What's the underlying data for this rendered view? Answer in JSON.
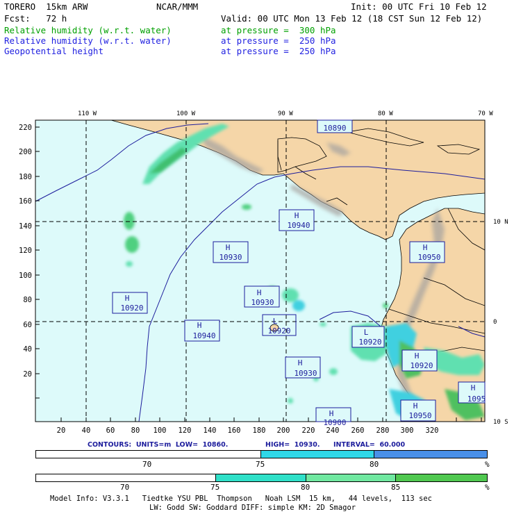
{
  "header": {
    "model": "TORERO  15km ARW",
    "center": "NCAR/MMM",
    "init": "Init: 00 UTC Fri 10 Feb 12",
    "fcst": "Fcst:   72 h",
    "valid": "Valid: 00 UTC Mon 13 Feb 12 (18 CST Sun 12 Feb 12)",
    "fields": [
      {
        "name": "Relative humidity (w.r.t. water)",
        "level": "at pressure =  300 hPa",
        "color": "#00a000"
      },
      {
        "name": "Relative humidity (w.r.t. water)",
        "level": "at pressure =  250 hPa",
        "color": "#1e1ee0"
      },
      {
        "name": "Geopotential height",
        "level": "at pressure =  250 hPa",
        "color": "#1e1ee0"
      }
    ]
  },
  "map": {
    "top_lon_labels": [
      "110 W",
      "100 W",
      "90 W",
      "80 W",
      "70 W"
    ],
    "right_lat_labels": [
      "10 N",
      "0",
      "10 S"
    ],
    "left_y_ticks": [
      "220",
      "200",
      "180",
      "160",
      "140",
      "120",
      "100",
      "80",
      "60",
      "40",
      "20"
    ],
    "bottom_x_ticks": [
      "20",
      "40",
      "60",
      "80",
      "100",
      "120",
      "140",
      "160",
      "180",
      "200",
      "220",
      "240",
      "260",
      "280",
      "300",
      "320"
    ],
    "highs_lows": [
      {
        "type": "H",
        "value": "10890"
      },
      {
        "type": "H",
        "value": "10940"
      },
      {
        "type": "H",
        "value": "10930"
      },
      {
        "type": "H",
        "value": "10950"
      },
      {
        "type": "H",
        "value": "10920"
      },
      {
        "type": "H",
        "value": "10930"
      },
      {
        "type": "H",
        "value": "10940"
      },
      {
        "type": "L",
        "value": "10920"
      },
      {
        "type": "L",
        "value": "10920"
      },
      {
        "type": "H",
        "value": "10930"
      },
      {
        "type": "H",
        "value": "10920"
      },
      {
        "type": "H",
        "value": "1095"
      },
      {
        "type": "H",
        "value": "10950"
      },
      {
        "type": "H",
        "value": "10900"
      }
    ],
    "colors": {
      "ocean": "#ddfafa",
      "land": "#f5d6a8",
      "terrain_gray": "#a8a4a0",
      "contour": "#1c1c9c"
    }
  },
  "contour_info": {
    "units": "CONTOURS:  UNITS=m  LOW=  10860.",
    "high": "HIGH=  10930.",
    "interval": "INTERVAL=  60.000"
  },
  "legend_250": {
    "ticks": [
      "70",
      "75",
      "80"
    ],
    "unit": "%",
    "colors": [
      "#ffffff",
      "#30d8e8",
      "#4a90e8"
    ]
  },
  "legend_300": {
    "ticks": [
      "70",
      "75",
      "80",
      "85"
    ],
    "unit": "%",
    "colors": [
      "#ffffff",
      "#30e0c8",
      "#70e8a0",
      "#50c850"
    ]
  },
  "footer": {
    "line1": "Model Info: V3.3.1   Tiedtke YSU PBL  Thompson   Noah LSM  15 km,   44 levels,  113 sec",
    "line2": "LW: Godd SW: Goddard DIFF: simple KM: 2D Smagor"
  }
}
